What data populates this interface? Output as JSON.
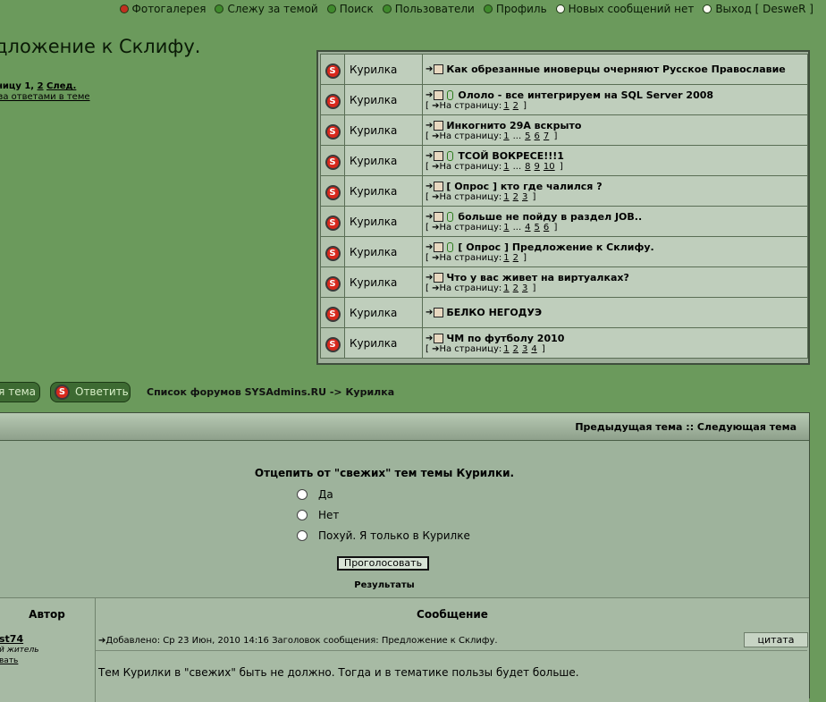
{
  "nav": {
    "items": [
      {
        "label": "Фотогалерея",
        "icon": "red"
      },
      {
        "label": "Слежу за темой",
        "icon": "green"
      },
      {
        "label": "Поиск",
        "icon": "green"
      },
      {
        "label": "Пользователи",
        "icon": "green"
      },
      {
        "label": "Профиль",
        "icon": "green"
      },
      {
        "label": "Новых сообщений нет",
        "icon": "white"
      },
      {
        "label": "Выход [ DesweR ]",
        "icon": "clock"
      }
    ]
  },
  "page": {
    "title": "дложение к Склифу.",
    "pagination_prefix": "ницу 1,",
    "pagination_page2": "2",
    "pagination_next": "След.",
    "watch_link": "за ответами в теме"
  },
  "side_topics": [
    {
      "forum": "Курилка",
      "title": "Как обрезанные иноверцы очерняют Русское Православие",
      "clip": false,
      "pages": []
    },
    {
      "forum": "Курилка",
      "title": "Ололо - все интегрируем на SQL Server 2008",
      "clip": true,
      "pages": [
        "1",
        "2"
      ]
    },
    {
      "forum": "Курилка",
      "title": "Инкогнито 29А вскрыто",
      "clip": false,
      "pages": [
        "1",
        "...",
        "5",
        "6",
        "7"
      ]
    },
    {
      "forum": "Курилка",
      "title": "ТСОЙ ВОКРЕСЕ!!!1",
      "clip": true,
      "pages": [
        "1",
        "...",
        "8",
        "9",
        "10"
      ]
    },
    {
      "forum": "Курилка",
      "title": "[ Опрос ] кто где чалился ?",
      "clip": false,
      "pages": [
        "1",
        "2",
        "3"
      ]
    },
    {
      "forum": "Курилка",
      "title": "больше не пойду в раздел JOB..",
      "clip": true,
      "pages": [
        "1",
        "...",
        "4",
        "5",
        "6"
      ]
    },
    {
      "forum": "Курилка",
      "title": "[ Опрос ] Предложение к Склифу.",
      "clip": true,
      "pages": [
        "1",
        "2"
      ]
    },
    {
      "forum": "Курилка",
      "title": "Что у вас живет на виртуалках?",
      "clip": false,
      "pages": [
        "1",
        "2",
        "3"
      ]
    },
    {
      "forum": "Курилка",
      "title": "БЕЛКО НЕГОДУЭ",
      "clip": false,
      "pages": []
    },
    {
      "forum": "Курилка",
      "title": "ЧМ по футболу 2010",
      "clip": false,
      "pages": [
        "1",
        "2",
        "3",
        "4"
      ]
    }
  ],
  "pages_prefix": "[ ",
  "pages_label": "На страницу:",
  "pages_suffix": " ]",
  "buttons": {
    "new_topic": "ая тема",
    "reply": "Ответить"
  },
  "breadcrumb": "Список форумов SYSAdmins.RU -> Курилка",
  "topic_nav": "Предыдущая тема :: Следующая тема",
  "poll": {
    "question": "Отцепить от \"свежих\" тем темы Курилки.",
    "options": [
      "Да",
      "Нет",
      "Похуй. Я только в Курилке"
    ],
    "vote_button": "Проголосовать",
    "results": "Результаты"
  },
  "posts_header": {
    "author": "Автор",
    "message": "Сообщение"
  },
  "post": {
    "author_name": "st74",
    "author_rank": "й житель",
    "author_link": "вать",
    "meta": "Добавлено: Ср 23 Июн, 2010 14:16    Заголовок сообщения: Предложение к Склифу.",
    "quote_button": "цитата",
    "body": "Тем Курилки в \"свежих\" быть не должно. Тогда и в тематике пользы будет больше."
  }
}
